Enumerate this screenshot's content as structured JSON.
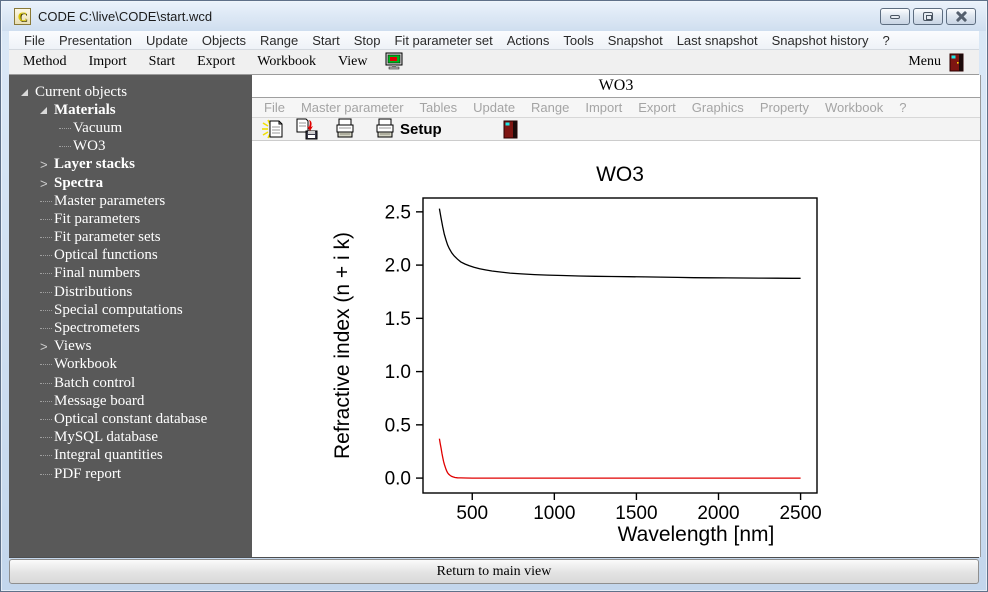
{
  "window": {
    "title": "CODE C:\\live\\CODE\\start.wcd",
    "icon_letter": "C"
  },
  "menubar": {
    "items": [
      "File",
      "Presentation",
      "Update",
      "Objects",
      "Range",
      "Start",
      "Stop",
      "Fit parameter set",
      "Actions",
      "Tools",
      "Snapshot",
      "Last snapshot",
      "Snapshot history",
      "?"
    ]
  },
  "toolbar": {
    "items": [
      "Method",
      "Import",
      "Start",
      "Export",
      "Workbook",
      "View"
    ],
    "right_label": "Menu"
  },
  "sidebar": {
    "items": [
      {
        "label": "Current objects",
        "level": 0,
        "bold": false,
        "state": "expanded"
      },
      {
        "label": "Materials",
        "level": 1,
        "bold": true,
        "state": "expanded"
      },
      {
        "label": "Vacuum",
        "level": 2,
        "bold": false,
        "state": "leaf"
      },
      {
        "label": "WO3",
        "level": 2,
        "bold": false,
        "state": "leaf"
      },
      {
        "label": "Layer stacks",
        "level": 1,
        "bold": true,
        "state": "collapsed"
      },
      {
        "label": "Spectra",
        "level": 1,
        "bold": true,
        "state": "collapsed"
      },
      {
        "label": "Master parameters",
        "level": 1,
        "bold": false,
        "state": "leaf"
      },
      {
        "label": "Fit parameters",
        "level": 1,
        "bold": false,
        "state": "leaf"
      },
      {
        "label": "Fit parameter sets",
        "level": 1,
        "bold": false,
        "state": "leaf"
      },
      {
        "label": "Optical functions",
        "level": 1,
        "bold": false,
        "state": "leaf"
      },
      {
        "label": "Final numbers",
        "level": 1,
        "bold": false,
        "state": "leaf"
      },
      {
        "label": "Distributions",
        "level": 1,
        "bold": false,
        "state": "leaf"
      },
      {
        "label": "Special computations",
        "level": 1,
        "bold": false,
        "state": "leaf"
      },
      {
        "label": "Spectrometers",
        "level": 1,
        "bold": false,
        "state": "leaf"
      },
      {
        "label": "Views",
        "level": 1,
        "bold": false,
        "state": "collapsed"
      },
      {
        "label": "Workbook",
        "level": 1,
        "bold": false,
        "state": "leaf"
      },
      {
        "label": "Batch control",
        "level": 1,
        "bold": false,
        "state": "leaf"
      },
      {
        "label": "Message board",
        "level": 1,
        "bold": false,
        "state": "leaf"
      },
      {
        "label": "Optical constant database",
        "level": 1,
        "bold": false,
        "state": "leaf"
      },
      {
        "label": "MySQL database",
        "level": 1,
        "bold": false,
        "state": "leaf"
      },
      {
        "label": "Integral quantities",
        "level": 1,
        "bold": false,
        "state": "leaf"
      },
      {
        "label": "PDF report",
        "level": 1,
        "bold": false,
        "state": "leaf"
      }
    ]
  },
  "panel": {
    "title": "WO3",
    "menu_items": [
      "File",
      "Master parameter",
      "Tables",
      "Update",
      "Range",
      "Import",
      "Export",
      "Graphics",
      "Property",
      "Workbook",
      "?"
    ],
    "setup_label": "Setup"
  },
  "bottom": {
    "button_label": "Return to main view"
  },
  "colors": {
    "n_curve": "#000000",
    "k_curve": "#e00000",
    "sidebar_bg": "#595959"
  },
  "chart_data": {
    "type": "line",
    "title": "WO3",
    "xlabel": "Wavelength [nm]",
    "ylabel": "Refractive index (n + i k)",
    "xlim": [
      200,
      2600
    ],
    "ylim": [
      -0.14,
      2.63
    ],
    "xticks": [
      500,
      1000,
      1500,
      2000,
      2500
    ],
    "yticks": [
      0.0,
      0.5,
      1.0,
      1.5,
      2.0,
      2.5
    ],
    "grid": false,
    "legend": "none",
    "series": [
      {
        "name": "n",
        "color": "#000000",
        "points": [
          [
            300,
            2.53
          ],
          [
            310,
            2.44
          ],
          [
            320,
            2.36
          ],
          [
            330,
            2.29
          ],
          [
            340,
            2.235
          ],
          [
            350,
            2.19
          ],
          [
            360,
            2.155
          ],
          [
            375,
            2.115
          ],
          [
            390,
            2.085
          ],
          [
            410,
            2.055
          ],
          [
            430,
            2.03
          ],
          [
            455,
            2.01
          ],
          [
            480,
            1.995
          ],
          [
            510,
            1.98
          ],
          [
            545,
            1.965
          ],
          [
            580,
            1.955
          ],
          [
            620,
            1.945
          ],
          [
            670,
            1.935
          ],
          [
            730,
            1.925
          ],
          [
            800,
            1.917
          ],
          [
            880,
            1.911
          ],
          [
            960,
            1.906
          ],
          [
            1050,
            1.902
          ],
          [
            1150,
            1.898
          ],
          [
            1250,
            1.895
          ],
          [
            1350,
            1.893
          ],
          [
            1450,
            1.891
          ],
          [
            1550,
            1.889
          ],
          [
            1650,
            1.887
          ],
          [
            1750,
            1.884
          ],
          [
            1850,
            1.882
          ],
          [
            1950,
            1.881
          ],
          [
            2050,
            1.88
          ],
          [
            2150,
            1.879
          ],
          [
            2250,
            1.878
          ],
          [
            2350,
            1.877
          ],
          [
            2450,
            1.876
          ],
          [
            2500,
            1.876
          ]
        ]
      },
      {
        "name": "k",
        "color": "#e00000",
        "points": [
          [
            300,
            0.37
          ],
          [
            305,
            0.325
          ],
          [
            310,
            0.28
          ],
          [
            315,
            0.235
          ],
          [
            320,
            0.195
          ],
          [
            325,
            0.16
          ],
          [
            330,
            0.13
          ],
          [
            335,
            0.105
          ],
          [
            340,
            0.083
          ],
          [
            345,
            0.065
          ],
          [
            350,
            0.05
          ],
          [
            357,
            0.036
          ],
          [
            365,
            0.025
          ],
          [
            375,
            0.016
          ],
          [
            385,
            0.01
          ],
          [
            395,
            0.006
          ],
          [
            410,
            0.003
          ],
          [
            430,
            0.0015
          ],
          [
            460,
            0.0007
          ],
          [
            500,
            0.0003
          ],
          [
            600,
            0.0001
          ],
          [
            800,
            0
          ],
          [
            1200,
            0
          ],
          [
            1600,
            0
          ],
          [
            2000,
            0
          ],
          [
            2500,
            0
          ]
        ]
      }
    ]
  }
}
